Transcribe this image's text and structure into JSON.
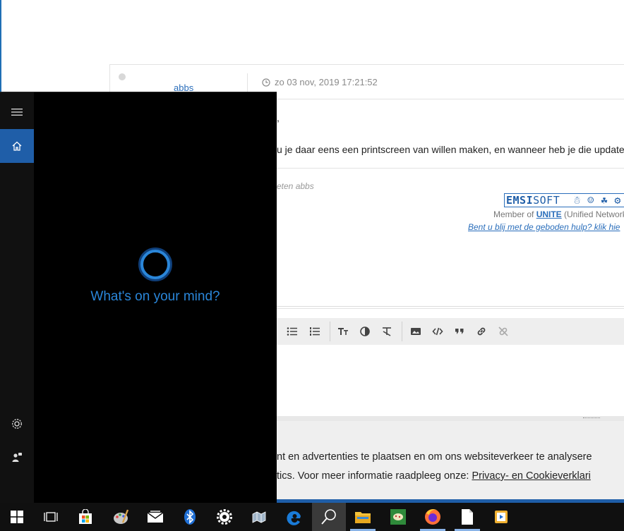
{
  "forum": {
    "username": "abbs",
    "post_date": "zo 03 nov, 2019 17:21:52",
    "post_line1": ",",
    "post_line2": "u je daar eens een printscreen van willen maken, en wanneer heb je die update",
    "signature_name": "eten abbs",
    "logo_text_bold": "EMSI",
    "logo_text_rest": "SOFT",
    "member_prefix": "Member of ",
    "member_unite": "UNITE",
    "member_suffix": " (Unified Network",
    "help_link": "Bent u blij met de geboden hulp? klik hie"
  },
  "cookie": {
    "line1": "nt en advertenties te plaatsen en om ons websiteverkeer te analysere",
    "line2_prefix": "tics. Voor meer informatie raadpleeg onze:  ",
    "line2_link": "Privacy- en Cookieverklari"
  },
  "cortana": {
    "prompt": "What's on your mind?",
    "accent_color": "#1f5ea8"
  },
  "taskbar": {
    "items": [
      "windows-start",
      "task-view",
      "store",
      "paint",
      "mail",
      "bluetooth",
      "settings",
      "maps",
      "edge",
      "search",
      "file-explorer",
      "game",
      "firefox",
      "notepad",
      "media-player"
    ]
  }
}
